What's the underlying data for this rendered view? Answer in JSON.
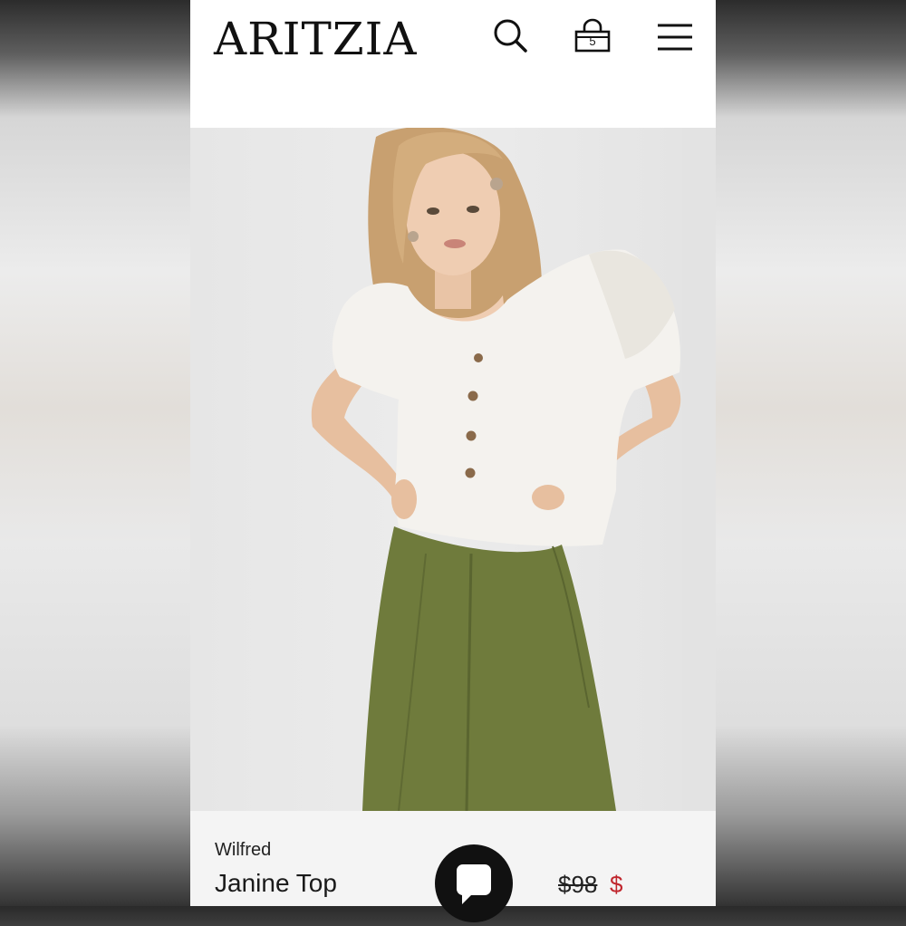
{
  "header": {
    "logo_text": "ARITZIA",
    "bag_count": "5",
    "icons": [
      "search-icon",
      "shopping-bag-icon",
      "hamburger-menu-icon"
    ]
  },
  "product": {
    "brand": "Wilfred",
    "name": "Janine Top",
    "original_price": "$98",
    "sale_price_visible": "$",
    "image": "model-wearing-white-puff-sleeve-button-top-and-green-pleated-pants"
  },
  "chat": {
    "icon": "chat-bubble-icon"
  },
  "colors": {
    "sale_red": "#c0262d",
    "top_white": "#f4f2ee",
    "pants_green": "#6e7a3a",
    "background": "#ececec"
  }
}
